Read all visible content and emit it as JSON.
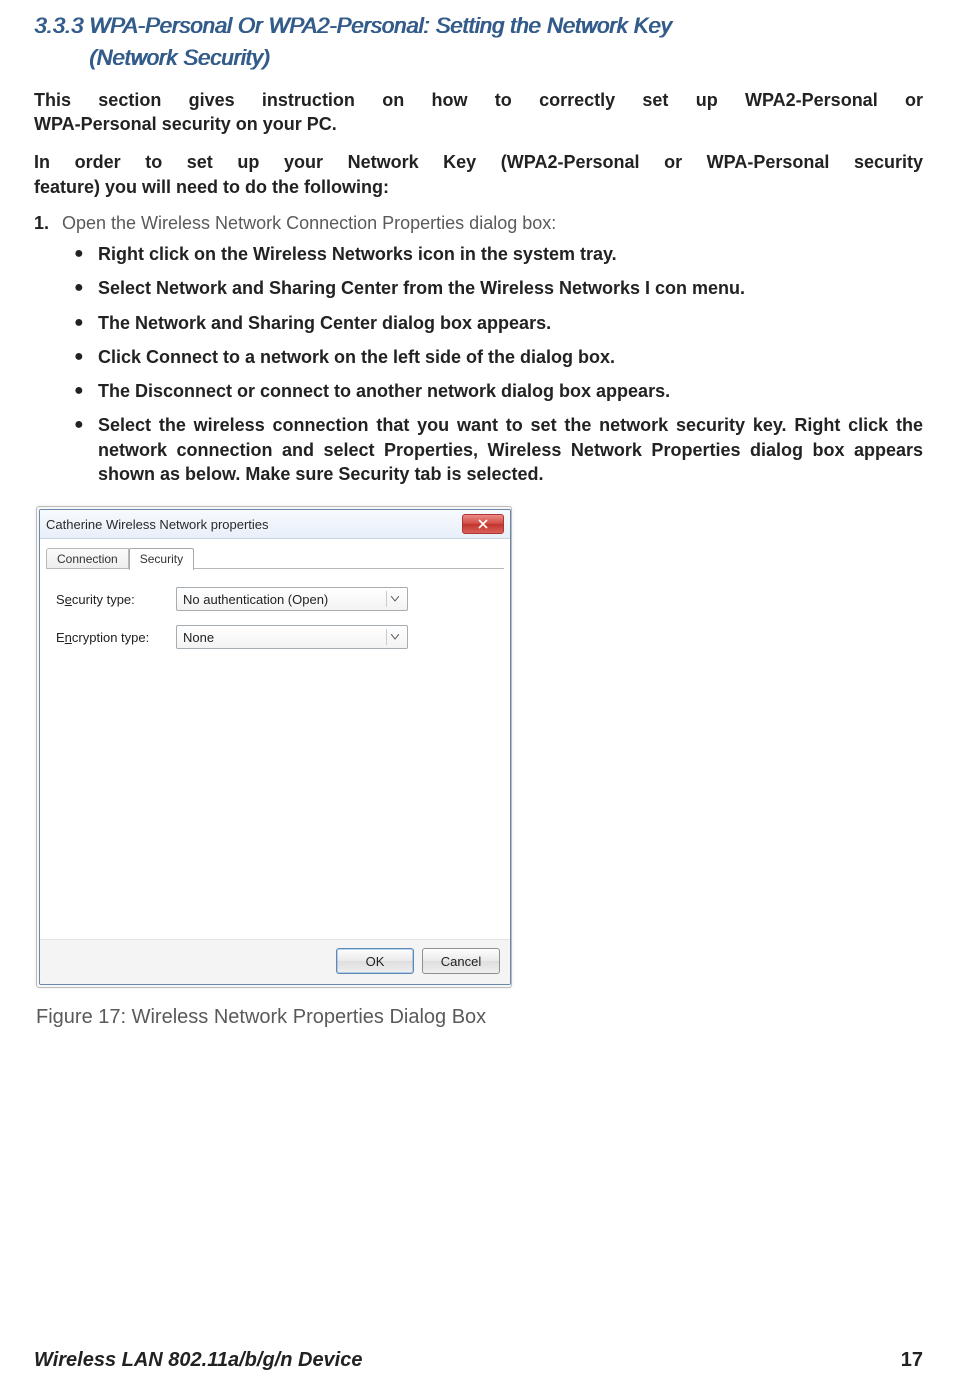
{
  "heading": {
    "number": "3.3.3",
    "title_line1": "WPA-Personal Or WPA2-Personal:  Setting the Network Key",
    "title_line2": "(Network Security)"
  },
  "paragraphs": {
    "intro1_line1": "This section gives instruction on how to correctly set up WPA2-Personal or",
    "intro1_line2": "WPA-Personal security on your PC.",
    "intro2_line1": "In order to set up your Network Key (WPA2-Personal or WPA-Personal security",
    "intro2_line2": "feature) you will need to do the following:"
  },
  "step1": {
    "number": "1.",
    "text": "Open the Wireless Network Connection Properties dialog box:"
  },
  "bullets": [
    "Right click on the Wireless Networks icon in the system tray.",
    "Select Network and Sharing Center from the Wireless Networks I con menu.",
    "The Network and Sharing Center dialog box appears.",
    "Click Connect to a network on the left side of the dialog box.",
    "The Disconnect or connect to another network dialog box appears.",
    "Select the wireless connection that you want to set the network security key. Right click the network connection and select Properties, Wireless Network Properties dialog box appears shown as below.  Make sure Security tab is selected."
  ],
  "dialog": {
    "title": "Catherine Wireless Network properties",
    "tabs": {
      "connection": "Connection",
      "security": "Security"
    },
    "security_type": {
      "label_pre": "S",
      "label_u": "e",
      "label_post": "curity type:",
      "value": "No authentication (Open)"
    },
    "encryption_type": {
      "label_pre": "E",
      "label_u": "n",
      "label_post": "cryption type:",
      "value": "None"
    },
    "buttons": {
      "ok": "OK",
      "cancel": "Cancel"
    }
  },
  "figure_caption": "Figure 17: Wireless Network Properties Dialog Box",
  "footer": {
    "doc_title": "Wireless LAN 802.11a/b/g/n Device",
    "page_number": "17"
  }
}
